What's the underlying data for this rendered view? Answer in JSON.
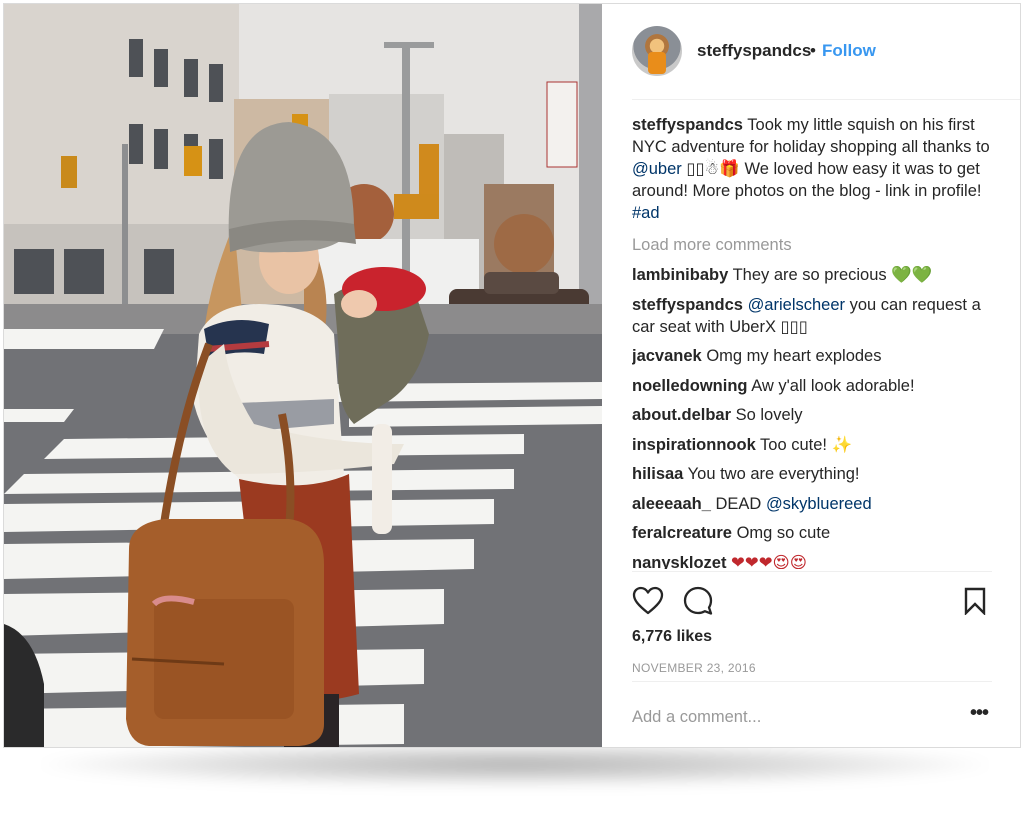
{
  "post": {
    "username": "steffyspandcs",
    "separator": "•",
    "follow_label": "Follow",
    "avatar_icon": "profile-photo",
    "photo_icon": "post-photo"
  },
  "caption": {
    "username": "steffyspandcs",
    "text_1": "Took my little squish on his first NYC adventure for holiday shopping all thanks to ",
    "mention": "@uber",
    "emoji": "▯▯☃🎁",
    "text_2": " We loved how easy it was to get around! More photos on the blog - link in profile! ",
    "hashtag": "#ad"
  },
  "load_more": "Load more comments",
  "comments": [
    {
      "user": "lambinibaby",
      "pre": "They are so precious",
      "mention": "",
      "post": "",
      "emoji": "💚💚"
    },
    {
      "user": "steffyspandcs",
      "pre": "",
      "mention": "@arielscheer",
      "post": " you can request a car seat with UberX ▯▯▯",
      "emoji": ""
    },
    {
      "user": "jacvanek",
      "pre": "Omg my heart explodes",
      "mention": "",
      "post": "",
      "emoji": ""
    },
    {
      "user": "noelledowning",
      "pre": "Aw y'all look adorable!",
      "mention": "",
      "post": "",
      "emoji": ""
    },
    {
      "user": "about.delbar",
      "pre": "So lovely",
      "mention": "",
      "post": "",
      "emoji": ""
    },
    {
      "user": "inspirationnook",
      "pre": "Too cute!",
      "mention": "",
      "post": "",
      "emoji": "✨"
    },
    {
      "user": "hilisaa",
      "pre": "You two are everything!",
      "mention": "",
      "post": "",
      "emoji": ""
    },
    {
      "user": "aleeeaah_",
      "pre": "DEAD ",
      "mention": "@skybluereed",
      "post": "",
      "emoji": ""
    },
    {
      "user": "feralcreature",
      "pre": "Omg so cute",
      "mention": "",
      "post": "",
      "emoji": ""
    },
    {
      "user": "nanysklozet",
      "pre": "",
      "mention": "",
      "post": "",
      "emoji": "❤❤❤😍😍"
    }
  ],
  "actions": {
    "like_icon": "heart-icon",
    "comment_icon": "comment-bubble-icon",
    "save_icon": "bookmark-icon"
  },
  "likes": "6,776 likes",
  "date": "NOVEMBER 23, 2016",
  "add_comment": {
    "placeholder": "Add a comment...",
    "more_label": "•••"
  },
  "colors": {
    "link_blue": "#3897f0",
    "mention": "#003569",
    "muted": "#999999",
    "text": "#262626"
  }
}
